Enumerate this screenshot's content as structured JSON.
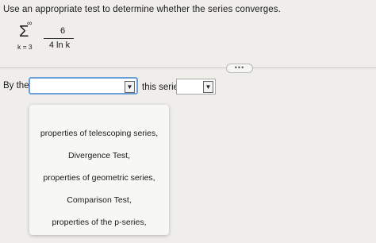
{
  "question": {
    "text": "Use an appropriate test to determine whether the series converges."
  },
  "series": {
    "upper_limit": "∞",
    "sigma": "Σ",
    "lower_limit": "k = 3",
    "numerator": "6",
    "denominator": "4 ln k"
  },
  "more_button": {
    "label": "•••"
  },
  "answer": {
    "prefix": "By the",
    "middle": "this series",
    "first_select_value": "",
    "second_select_value": "",
    "arrow": "▼"
  },
  "dropdown": {
    "options": [
      "properties of telescoping series,",
      "Divergence Test,",
      "properties of geometric series,",
      "Comparison Test,",
      "properties of the p-series,"
    ]
  }
}
